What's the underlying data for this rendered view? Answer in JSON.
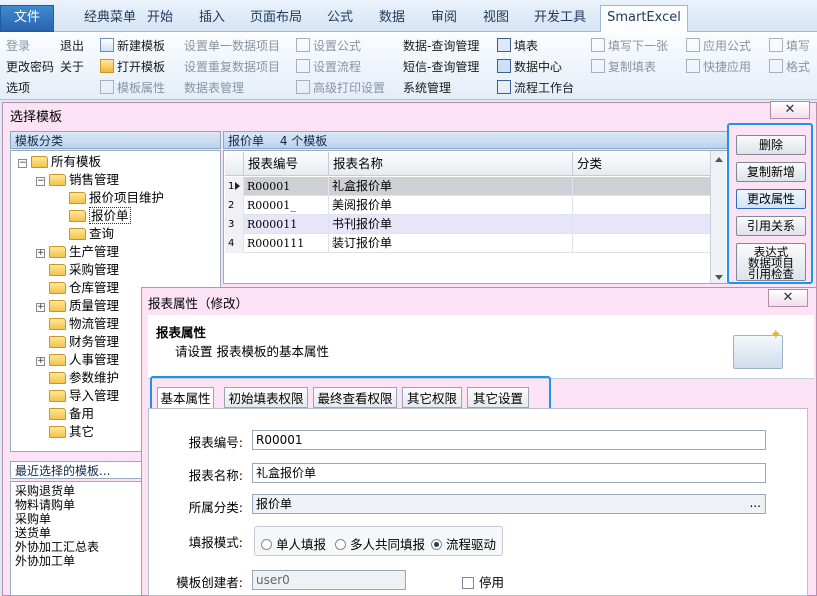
{
  "ribbon": {
    "tabs": [
      "文件",
      "经典菜单",
      "开始",
      "插入",
      "页面布局",
      "公式",
      "数据",
      "审阅",
      "视图",
      "开发工具",
      "SmartExcel"
    ],
    "groups": {
      "account": [
        "登录",
        "退出",
        "更改密码",
        "关于",
        "选项"
      ],
      "template": [
        "新建模板",
        "打开模板",
        "模板属性"
      ],
      "setup": [
        "设置单一数据项目",
        "设置重复数据项目",
        "数据表管理"
      ],
      "formula": [
        "设置公式",
        "设置流程",
        "高级打印设置"
      ],
      "query": [
        "数据-查询管理",
        "短信-查询管理",
        "系统管理"
      ],
      "fill": [
        "填表",
        "数据中心",
        "流程工作台"
      ],
      "nav": [
        "填写下一张",
        "复制填表"
      ],
      "apply": [
        "应用公式",
        "快捷应用"
      ],
      "write": [
        "填写",
        "格式"
      ]
    }
  },
  "select_dialog": {
    "title": "选择模板",
    "close": "✕",
    "tree_header": "模板分类",
    "tree": {
      "root": "所有模板",
      "sales": "销售管理",
      "sales_children": [
        "报价项目维护",
        "报价单",
        "查询"
      ],
      "others": [
        "生产管理",
        "采购管理",
        "仓库管理",
        "质量管理",
        "物流管理",
        "财务管理",
        "人事管理",
        "参数维护",
        "导入管理",
        "备用",
        "其它"
      ]
    },
    "recent_header": "最近选择的模板...",
    "recent": [
      "采购退货单",
      "物料请购单",
      "采购单",
      "送货单",
      "外协加工汇总表",
      "外协加工单"
    ],
    "grid_title": "报价单",
    "grid_count": "4 个模板",
    "columns": [
      "报表编号",
      "报表名称",
      "分类"
    ],
    "rows": [
      {
        "n": "1",
        "code": "R00001",
        "name": "礼盒报价单",
        "cat": ""
      },
      {
        "n": "2",
        "code": "R00001_",
        "name": "美阅报价单",
        "cat": ""
      },
      {
        "n": "3",
        "code": "R000011",
        "name": "书刊报价单",
        "cat": ""
      },
      {
        "n": "4",
        "code": "R0000111",
        "name": "装订报价单",
        "cat": ""
      }
    ],
    "buttons": [
      "删除",
      "复制新增",
      "更改属性",
      "引用关系",
      "表达式\n数据项目\n引用检查"
    ]
  },
  "prop_dialog": {
    "title": "报表属性（修改）",
    "close": "✕",
    "heading": "报表属性",
    "subheading": "请设置 报表模板的基本属性",
    "tabs": [
      "基本属性",
      "初始填表权限",
      "最终查看权限",
      "其它权限",
      "其它设置"
    ],
    "fields": {
      "code_label": "报表编号:",
      "code_value": "R00001",
      "name_label": "报表名称:",
      "name_value": "礼盒报价单",
      "cat_label": "所属分类:",
      "cat_value": "报价单",
      "cat_more": "...",
      "mode_label": "填报模式:",
      "modes": [
        "单人填报",
        "多人共同填报",
        "流程驱动"
      ],
      "mode_selected": 2,
      "creator_label": "模板创建者:",
      "creator_value": "user0",
      "disabled_label": "停用"
    }
  },
  "colors": {
    "accent_box": "#1e94e6",
    "dialog_bg": "#fbe3f5",
    "file_tab": "#2a63ad"
  }
}
